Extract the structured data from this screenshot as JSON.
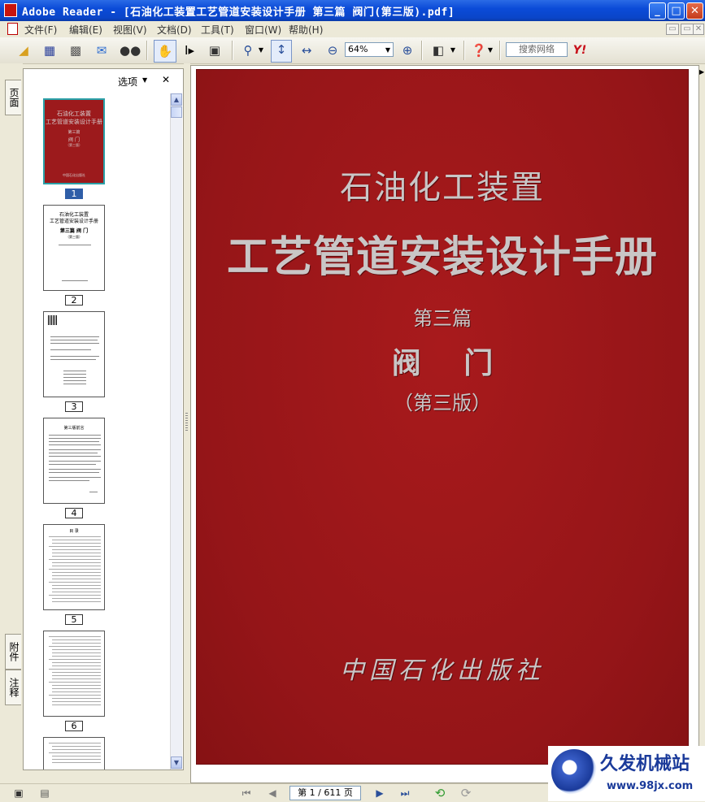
{
  "window": {
    "title": "Adobe Reader - [石油化工装置工艺管道安装设计手册 第三篇 阀门(第三版).pdf]",
    "minimize": "_",
    "maximize": "□",
    "close": "✕"
  },
  "menu": {
    "items": [
      "文件(F)",
      "编辑(E)",
      "视图(V)",
      "文档(D)",
      "工具(T)",
      "窗口(W)",
      "帮助(H)"
    ]
  },
  "toolbar": {
    "zoom_value": "64%",
    "search_placeholder": "搜索网络",
    "yahoo": "Y!"
  },
  "left_tabs": {
    "pages": "页面",
    "attachments": "附件",
    "comments": "注释"
  },
  "nav_panel": {
    "options_label": "选项",
    "close": "✕",
    "thumbnails": [
      {
        "label": "1",
        "selected": true
      },
      {
        "label": "2",
        "selected": false
      },
      {
        "label": "3",
        "selected": false
      },
      {
        "label": "4",
        "selected": false
      },
      {
        "label": "5",
        "selected": false
      },
      {
        "label": "6",
        "selected": false
      }
    ],
    "thumb2": {
      "line1": "石油化工装置",
      "line2": "工艺管道安装设计手册",
      "line3": "第三篇  阀  门",
      "line4": "（第三版）"
    },
    "thumb4_title": "第三版前言",
    "thumb5_title": "目  录"
  },
  "cover": {
    "line1": "石油化工装置",
    "line2": "工艺管道安装设计手册",
    "line3": "第三篇",
    "line4": "阀   门",
    "line5": "（第三版）",
    "publisher": "中国石化出版社"
  },
  "status": {
    "page_indicator": "第 1 / 611 页"
  },
  "watermark": {
    "brand": "久发机械站",
    "url": "www.98jx.com"
  }
}
